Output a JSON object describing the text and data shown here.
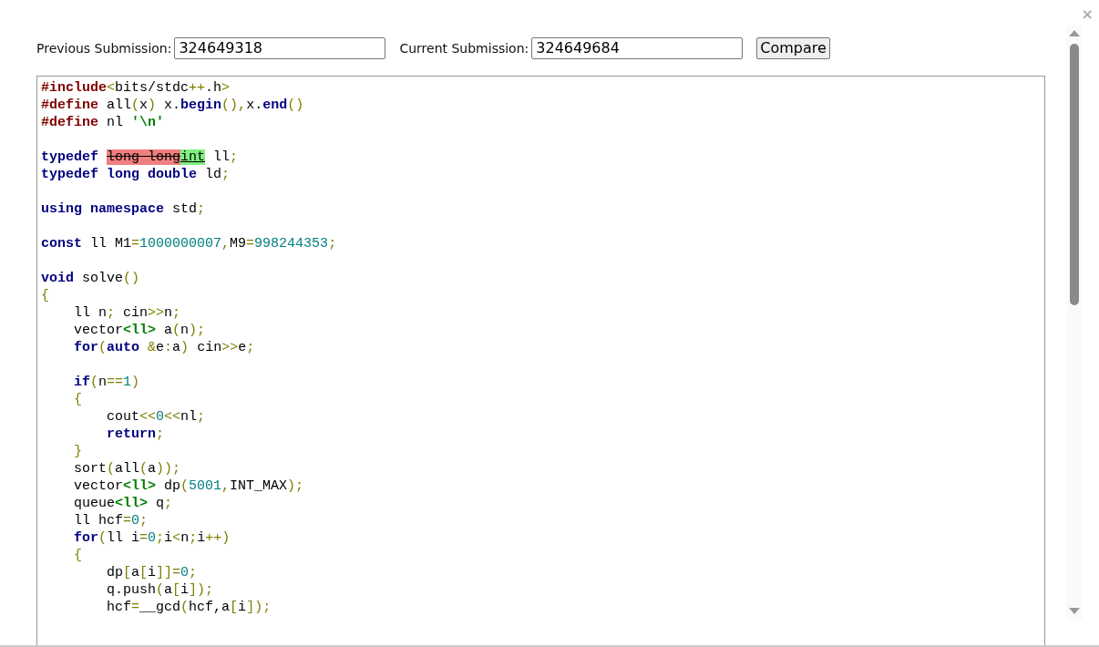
{
  "close": "×",
  "form": {
    "previous_label": "Previous Submission:",
    "previous_value": "324649318",
    "current_label": "Current Submission:",
    "current_value": "324649684",
    "button": "Compare"
  },
  "code_lines": [
    {
      "kind": "code",
      "tokens": [
        {
          "kind": "pre",
          "text": "#include"
        },
        {
          "kind": "op",
          "text": "<"
        },
        {
          "kind": "id",
          "text": "bits/stdc"
        },
        {
          "kind": "op",
          "text": "++"
        },
        {
          "kind": "id",
          "text": ".h"
        },
        {
          "kind": "op",
          "text": ">"
        }
      ]
    },
    {
      "kind": "code",
      "tokens": [
        {
          "kind": "pre",
          "text": "#define"
        },
        {
          "kind": "id",
          "text": " all"
        },
        {
          "kind": "op",
          "text": "("
        },
        {
          "kind": "id",
          "text": "x"
        },
        {
          "kind": "op",
          "text": ")"
        },
        {
          "kind": "id",
          "text": " x."
        },
        {
          "kind": "kw",
          "text": "begin"
        },
        {
          "kind": "op",
          "text": "(),"
        },
        {
          "kind": "id",
          "text": "x."
        },
        {
          "kind": "kw",
          "text": "end"
        },
        {
          "kind": "op",
          "text": "()"
        }
      ]
    },
    {
      "kind": "code",
      "tokens": [
        {
          "kind": "pre",
          "text": "#define"
        },
        {
          "kind": "id",
          "text": " nl "
        },
        {
          "kind": "str",
          "text": "'\\n'"
        }
      ]
    },
    {
      "kind": "blank"
    },
    {
      "kind": "code",
      "tokens": [
        {
          "kind": "kw",
          "text": "typedef "
        },
        {
          "kind": "del",
          "text": "long long"
        },
        {
          "kind": "ins",
          "text": "int"
        },
        {
          "kind": "id",
          "text": " ll"
        },
        {
          "kind": "op",
          "text": ";"
        }
      ]
    },
    {
      "kind": "code",
      "tokens": [
        {
          "kind": "kw",
          "text": "typedef long double"
        },
        {
          "kind": "id",
          "text": " ld"
        },
        {
          "kind": "op",
          "text": ";"
        }
      ]
    },
    {
      "kind": "blank"
    },
    {
      "kind": "code",
      "tokens": [
        {
          "kind": "kw",
          "text": "using namespace"
        },
        {
          "kind": "id",
          "text": " std"
        },
        {
          "kind": "op",
          "text": ";"
        }
      ]
    },
    {
      "kind": "blank"
    },
    {
      "kind": "code",
      "tokens": [
        {
          "kind": "kw",
          "text": "const"
        },
        {
          "kind": "id",
          "text": " ll M1"
        },
        {
          "kind": "op",
          "text": "="
        },
        {
          "kind": "num",
          "text": "1000000007"
        },
        {
          "kind": "op",
          "text": ","
        },
        {
          "kind": "id",
          "text": "M9"
        },
        {
          "kind": "op",
          "text": "="
        },
        {
          "kind": "num",
          "text": "998244353"
        },
        {
          "kind": "op",
          "text": ";"
        }
      ]
    },
    {
      "kind": "blank"
    },
    {
      "kind": "code",
      "tokens": [
        {
          "kind": "kw",
          "text": "void"
        },
        {
          "kind": "id",
          "text": " solve"
        },
        {
          "kind": "op",
          "text": "()"
        }
      ]
    },
    {
      "kind": "code",
      "tokens": [
        {
          "kind": "op",
          "text": "{"
        }
      ]
    },
    {
      "kind": "code",
      "tokens": [
        {
          "kind": "id",
          "text": "    ll n"
        },
        {
          "kind": "op",
          "text": ";"
        },
        {
          "kind": "id",
          "text": " cin"
        },
        {
          "kind": "op",
          "text": ">>"
        },
        {
          "kind": "id",
          "text": "n"
        },
        {
          "kind": "op",
          "text": ";"
        }
      ]
    },
    {
      "kind": "code",
      "tokens": [
        {
          "kind": "id",
          "text": "    vector"
        },
        {
          "kind": "type",
          "text": "<ll>"
        },
        {
          "kind": "id",
          "text": " a"
        },
        {
          "kind": "op",
          "text": "("
        },
        {
          "kind": "id",
          "text": "n"
        },
        {
          "kind": "op",
          "text": ");"
        }
      ]
    },
    {
      "kind": "code",
      "tokens": [
        {
          "kind": "kw",
          "text": "    for"
        },
        {
          "kind": "op",
          "text": "("
        },
        {
          "kind": "kw",
          "text": "auto "
        },
        {
          "kind": "op",
          "text": "&"
        },
        {
          "kind": "id",
          "text": "e"
        },
        {
          "kind": "op",
          "text": ":"
        },
        {
          "kind": "id",
          "text": "a"
        },
        {
          "kind": "op",
          "text": ")"
        },
        {
          "kind": "id",
          "text": " cin"
        },
        {
          "kind": "op",
          "text": ">>"
        },
        {
          "kind": "id",
          "text": "e"
        },
        {
          "kind": "op",
          "text": ";"
        }
      ]
    },
    {
      "kind": "blank"
    },
    {
      "kind": "code",
      "tokens": [
        {
          "kind": "kw",
          "text": "    if"
        },
        {
          "kind": "op",
          "text": "("
        },
        {
          "kind": "id",
          "text": "n"
        },
        {
          "kind": "op",
          "text": "=="
        },
        {
          "kind": "num",
          "text": "1"
        },
        {
          "kind": "op",
          "text": ")"
        }
      ]
    },
    {
      "kind": "code",
      "tokens": [
        {
          "kind": "op",
          "text": "    {"
        }
      ]
    },
    {
      "kind": "code",
      "tokens": [
        {
          "kind": "id",
          "text": "        cout"
        },
        {
          "kind": "op",
          "text": "<<"
        },
        {
          "kind": "num",
          "text": "0"
        },
        {
          "kind": "op",
          "text": "<<"
        },
        {
          "kind": "id",
          "text": "nl"
        },
        {
          "kind": "op",
          "text": ";"
        }
      ]
    },
    {
      "kind": "code",
      "tokens": [
        {
          "kind": "kw",
          "text": "        return"
        },
        {
          "kind": "op",
          "text": ";"
        }
      ]
    },
    {
      "kind": "code",
      "tokens": [
        {
          "kind": "op",
          "text": "    }"
        }
      ]
    },
    {
      "kind": "code",
      "tokens": [
        {
          "kind": "id",
          "text": "    sort"
        },
        {
          "kind": "op",
          "text": "("
        },
        {
          "kind": "id",
          "text": "all"
        },
        {
          "kind": "op",
          "text": "("
        },
        {
          "kind": "id",
          "text": "a"
        },
        {
          "kind": "op",
          "text": "));"
        }
      ]
    },
    {
      "kind": "code",
      "tokens": [
        {
          "kind": "id",
          "text": "    vector"
        },
        {
          "kind": "type",
          "text": "<ll>"
        },
        {
          "kind": "id",
          "text": " dp"
        },
        {
          "kind": "op",
          "text": "("
        },
        {
          "kind": "num",
          "text": "5001"
        },
        {
          "kind": "op",
          "text": ","
        },
        {
          "kind": "id",
          "text": "INT_MAX"
        },
        {
          "kind": "op",
          "text": ");"
        }
      ]
    },
    {
      "kind": "code",
      "tokens": [
        {
          "kind": "id",
          "text": "    queue"
        },
        {
          "kind": "type",
          "text": "<ll>"
        },
        {
          "kind": "id",
          "text": " q"
        },
        {
          "kind": "op",
          "text": ";"
        }
      ]
    },
    {
      "kind": "code",
      "tokens": [
        {
          "kind": "id",
          "text": "    ll hcf"
        },
        {
          "kind": "op",
          "text": "="
        },
        {
          "kind": "num",
          "text": "0"
        },
        {
          "kind": "op",
          "text": ";"
        }
      ]
    },
    {
      "kind": "code",
      "tokens": [
        {
          "kind": "kw",
          "text": "    for"
        },
        {
          "kind": "op",
          "text": "("
        },
        {
          "kind": "id",
          "text": "ll i"
        },
        {
          "kind": "op",
          "text": "="
        },
        {
          "kind": "num",
          "text": "0"
        },
        {
          "kind": "op",
          "text": ";"
        },
        {
          "kind": "id",
          "text": "i"
        },
        {
          "kind": "op",
          "text": "<"
        },
        {
          "kind": "id",
          "text": "n"
        },
        {
          "kind": "op",
          "text": ";"
        },
        {
          "kind": "id",
          "text": "i"
        },
        {
          "kind": "op",
          "text": "++)"
        }
      ]
    },
    {
      "kind": "code",
      "tokens": [
        {
          "kind": "op",
          "text": "    {"
        }
      ]
    },
    {
      "kind": "code",
      "tokens": [
        {
          "kind": "id",
          "text": "        dp"
        },
        {
          "kind": "op",
          "text": "["
        },
        {
          "kind": "id",
          "text": "a"
        },
        {
          "kind": "op",
          "text": "["
        },
        {
          "kind": "id",
          "text": "i"
        },
        {
          "kind": "op",
          "text": "]]="
        },
        {
          "kind": "num",
          "text": "0"
        },
        {
          "kind": "op",
          "text": ";"
        }
      ]
    },
    {
      "kind": "code",
      "tokens": [
        {
          "kind": "id",
          "text": "        q.push"
        },
        {
          "kind": "op",
          "text": "("
        },
        {
          "kind": "id",
          "text": "a"
        },
        {
          "kind": "op",
          "text": "["
        },
        {
          "kind": "id",
          "text": "i"
        },
        {
          "kind": "op",
          "text": "]);"
        }
      ]
    },
    {
      "kind": "code",
      "tokens": [
        {
          "kind": "id",
          "text": "        hcf"
        },
        {
          "kind": "op",
          "text": "="
        },
        {
          "kind": "id",
          "text": "__gcd"
        },
        {
          "kind": "op",
          "text": "("
        },
        {
          "kind": "id",
          "text": "hcf,a"
        },
        {
          "kind": "op",
          "text": "["
        },
        {
          "kind": "id",
          "text": "i"
        },
        {
          "kind": "op",
          "text": "]);"
        }
      ]
    }
  ]
}
